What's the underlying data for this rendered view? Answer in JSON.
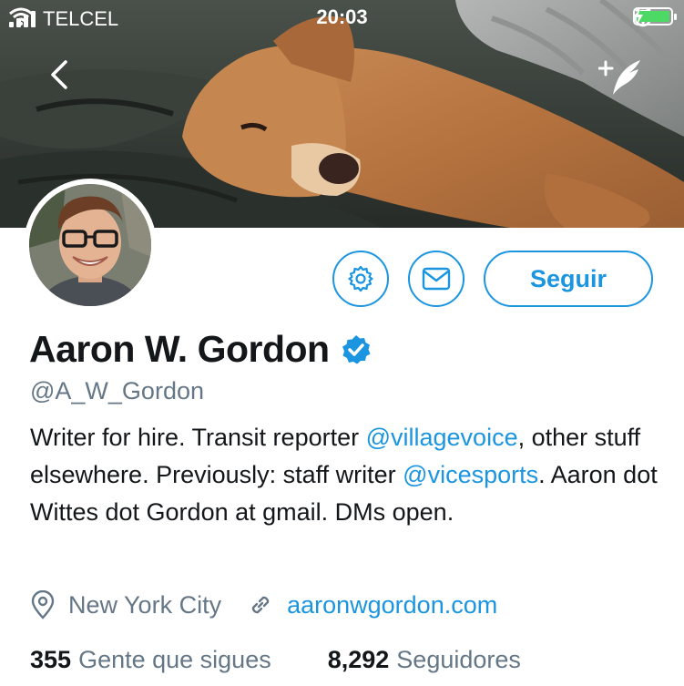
{
  "status_bar": {
    "carrier": "TELCEL",
    "time": "20:03",
    "signal_bars": 4,
    "battery_level": 1.0,
    "battery_color": "#4cd964"
  },
  "header": {
    "back_icon": "chevron-left-icon",
    "compose_icon": "compose-tweet-icon"
  },
  "actions": {
    "settings_icon": "gear-icon",
    "message_icon": "envelope-icon",
    "follow_label": "Seguir"
  },
  "profile": {
    "name": "Aaron W. Gordon",
    "verified": true,
    "handle": "@A_W_Gordon",
    "bio": {
      "part1": "Writer for hire. Transit reporter ",
      "mention1": "@villagevoice",
      "part2": ", other stuff elsewhere. Previously: staff writer ",
      "mention2": "@vicesports",
      "part3": ". Aaron dot Wittes dot Gordon at gmail. DMs open."
    },
    "location": "New York City",
    "website": "aaronwgordon.com"
  },
  "stats": {
    "following_count": "355",
    "following_label": "Gente que sigues",
    "followers_count": "8,292",
    "followers_label": "Seguidores"
  },
  "colors": {
    "accent": "#1b95e0",
    "secondary_text": "#657786",
    "primary_text": "#14171a"
  }
}
